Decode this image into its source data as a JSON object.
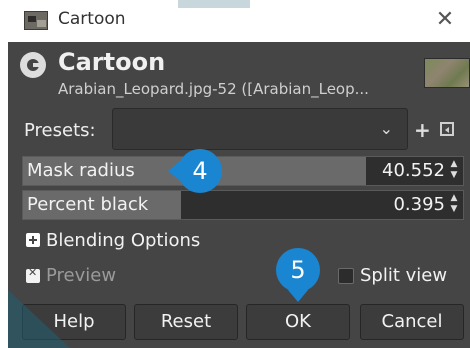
{
  "window": {
    "title": "Cartoon",
    "close_glyph": "✕"
  },
  "header": {
    "title": "Cartoon",
    "subtitle": "Arabian_Leopard.jpg-52 ([Arabian_Leop...",
    "logo_icon": "gimp-g-icon"
  },
  "presets": {
    "label": "Presets:",
    "value": "",
    "add_glyph": "+",
    "chevron_glyph": "⌄"
  },
  "params": {
    "mask_radius": {
      "label": "Mask radius",
      "value": "40.552",
      "fill": 0.78
    },
    "percent_black": {
      "label": "Percent black",
      "value": "0.395",
      "fill": 0.36
    },
    "arrows": "▲\n▼"
  },
  "options": {
    "blending_label": "Blending Options",
    "preview_label": "Preview",
    "preview_checked": true,
    "split_view_label": "Split view",
    "split_view_checked": false
  },
  "buttons": {
    "help": "Help",
    "reset": "Reset",
    "ok": "OK",
    "cancel": "Cancel"
  },
  "markers": {
    "step4": "4",
    "step5": "5"
  },
  "colors": {
    "dialog_bg": "#454545",
    "marker_blue": "#1a86d1",
    "accent_teal": "#1f5f73"
  }
}
